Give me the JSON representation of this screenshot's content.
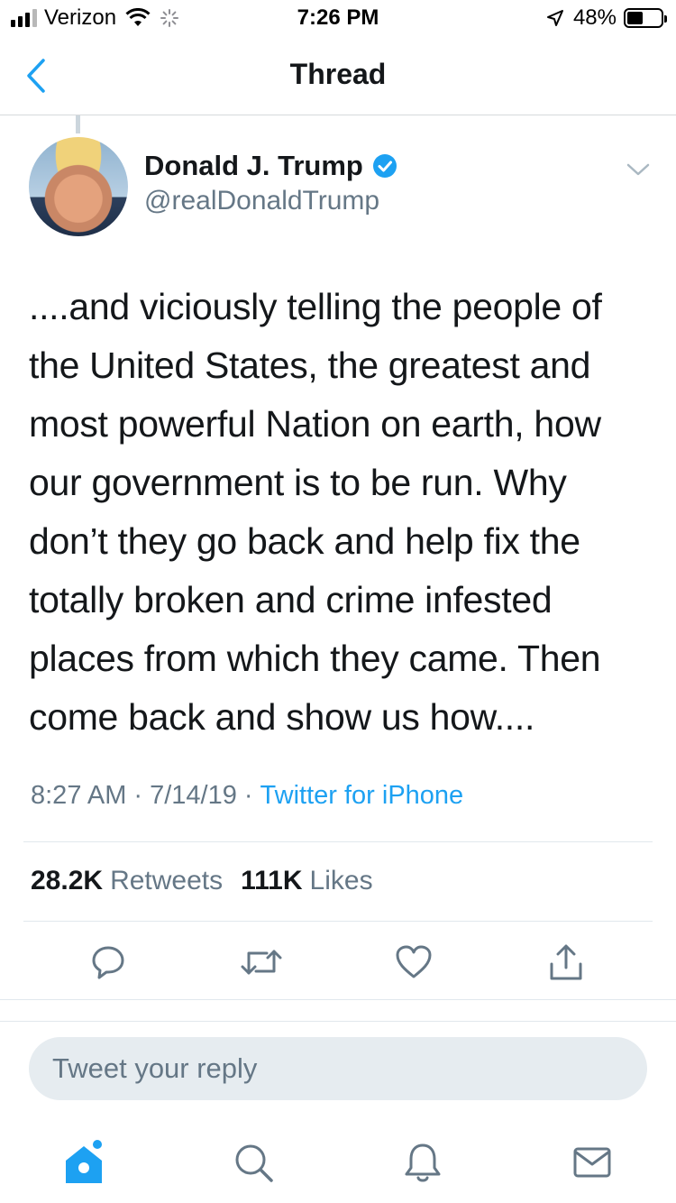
{
  "status_bar": {
    "carrier": "Verizon",
    "time": "7:26 PM",
    "battery_text": "48%",
    "battery_level": 0.48
  },
  "nav": {
    "title": "Thread"
  },
  "tweet": {
    "name": "Donald J. Trump",
    "handle": "@realDonaldTrump",
    "verified": true,
    "lines": [
      "....and viciously telling the people of",
      "the United States, the greatest and",
      "most powerful Nation on earth, how",
      "our government is to be run. Why",
      "don’t they go back and help fix the",
      "totally broken and crime infested",
      "places from which they came. Then",
      "come back and show us how...."
    ],
    "time": "8:27 AM",
    "date": "7/14/19",
    "source": "Twitter for iPhone",
    "separator": "·"
  },
  "stats": {
    "retweets_count": "28.2K",
    "retweets_label": "Retweets",
    "likes_count": "111K",
    "likes_label": "Likes"
  },
  "reply": {
    "placeholder": "Tweet your reply"
  },
  "colors": {
    "accent": "#1da1f2",
    "text": "#14171a",
    "secondary": "#657786",
    "divider": "#e1e8ed"
  },
  "icons": {
    "back": "chevron-left-icon",
    "caret": "chevron-down-icon",
    "reply": "reply-icon",
    "retweet": "retweet-icon",
    "like": "heart-icon",
    "share": "share-icon",
    "home": "home-icon",
    "search": "search-icon",
    "notifications": "bell-icon",
    "messages": "mail-icon"
  }
}
